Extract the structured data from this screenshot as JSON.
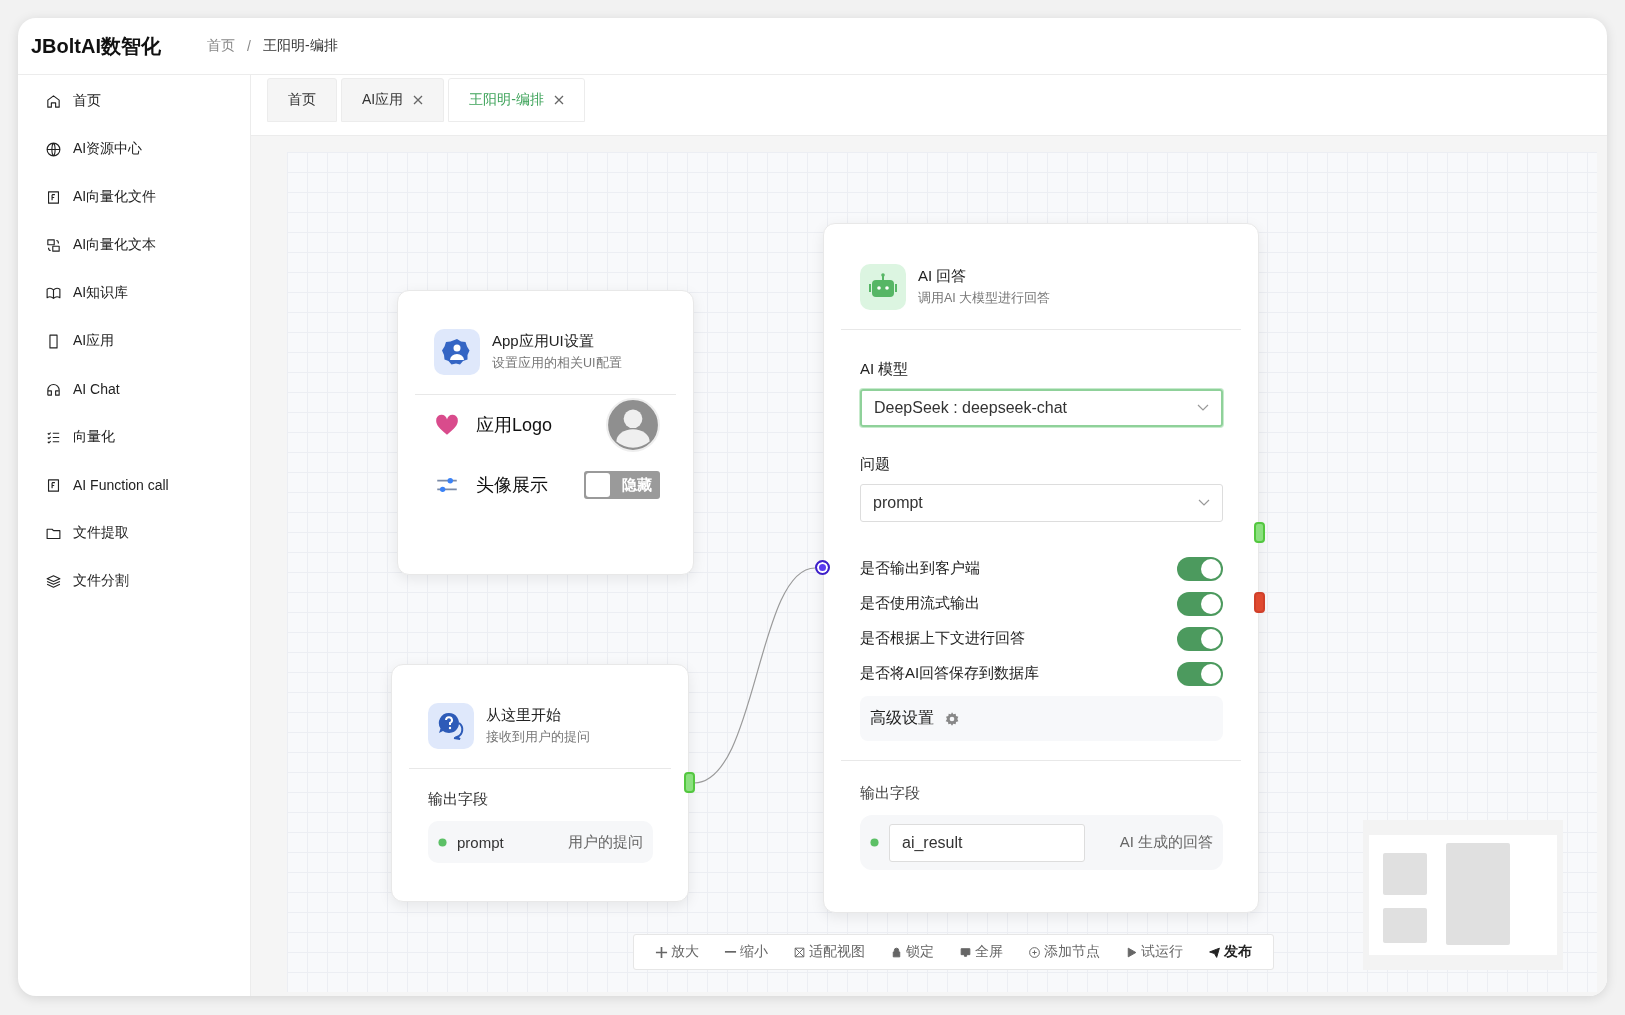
{
  "brand": "JBoltAI数智化",
  "breadcrumb": [
    "首页",
    "王阳明-编排"
  ],
  "breadcrumb_separator": "/",
  "sidebar": {
    "items": [
      {
        "label": "首页"
      },
      {
        "label": "AI资源中心"
      },
      {
        "label": "AI向量化文件"
      },
      {
        "label": "AI向量化文本"
      },
      {
        "label": "AI知识库"
      },
      {
        "label": "AI应用"
      },
      {
        "label": "AI Chat"
      },
      {
        "label": "向量化"
      },
      {
        "label": "AI Function call"
      },
      {
        "label": "文件提取"
      },
      {
        "label": "文件分割"
      }
    ]
  },
  "tabs": [
    {
      "label": "首页",
      "closable": false,
      "selected": false
    },
    {
      "label": "AI应用",
      "closable": true,
      "selected": false
    },
    {
      "label": "王阳明-编排",
      "closable": true,
      "selected": true
    }
  ],
  "app_ui_node": {
    "title": "App应用UI设置",
    "subtitle": "设置应用的相关UI配置",
    "logo_label": "应用Logo",
    "avatar_label": "头像展示",
    "avatar_switch": {
      "on": false,
      "text": "隐藏"
    }
  },
  "start_node": {
    "title": "从这里开始",
    "subtitle": "接收到用户的提问",
    "output_label": "输出字段",
    "fields": [
      {
        "name": "prompt",
        "description": "用户的提问"
      }
    ]
  },
  "ai_node": {
    "title": "AI 回答",
    "subtitle": "调用AI 大模型进行回答",
    "model_label": "AI 模型",
    "model_value": "DeepSeek : deepseek-chat",
    "model_focused": true,
    "question_label": "问题",
    "question_value": "prompt",
    "switches": [
      {
        "label": "是否输出到客户端",
        "on": true
      },
      {
        "label": "是否使用流式输出",
        "on": true
      },
      {
        "label": "是否根据上下文进行回答",
        "on": true
      },
      {
        "label": "是否将AI回答保存到数据库",
        "on": true
      }
    ],
    "advanced": "高级设置",
    "output_label": "输出字段",
    "fields": [
      {
        "name": "ai_result",
        "description": "AI 生成的回答"
      }
    ]
  },
  "toolbar": [
    {
      "label": "放大",
      "primary": false
    },
    {
      "label": "缩小",
      "primary": false
    },
    {
      "label": "适配视图",
      "primary": false
    },
    {
      "label": "锁定",
      "primary": false
    },
    {
      "label": "全屏",
      "primary": false
    },
    {
      "label": "添加节点",
      "primary": false
    },
    {
      "label": "试运行",
      "primary": false
    },
    {
      "label": "发布",
      "primary": true
    }
  ]
}
